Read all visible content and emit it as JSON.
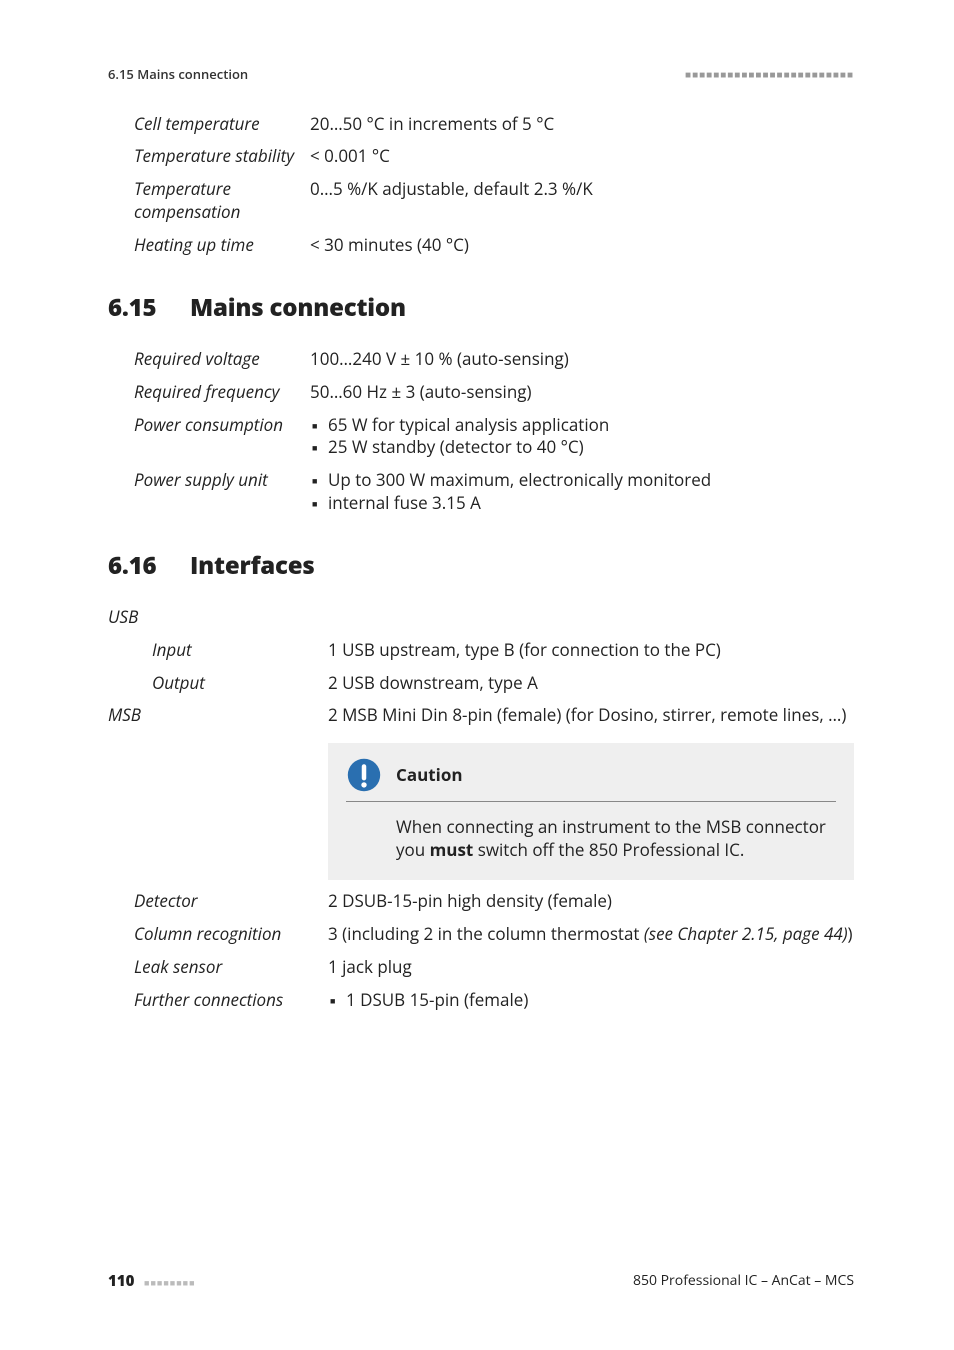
{
  "header": {
    "section_ref": "6.15 Mains connection",
    "rule": "■■■■■■■■■■■■■■■■■■■■■■■■"
  },
  "top_specs": [
    {
      "label": "Cell tempera­ture",
      "value": "20…50 °C in increments of 5 °C"
    },
    {
      "label": "Temperature stability",
      "value": "< 0.001 °C"
    },
    {
      "label": "Temperature compensation",
      "value": "0…5 %/K adjustable, default 2.3 %/K"
    },
    {
      "label": "Heating up time",
      "value": "< 30 minutes (40 °C)"
    }
  ],
  "sec615": {
    "num": "6.15",
    "title": "Mains connection",
    "rows": {
      "req_voltage": {
        "label": "Required voltage",
        "value": "100…240 V ± 10 % (auto-sensing)"
      },
      "req_freq": {
        "label": "Required fre­quency",
        "value": "50…60 Hz ± 3 (auto-sensing)"
      },
      "power_cons": {
        "label": "Power consump­tion",
        "items": [
          "65 W for typical analysis application",
          "25 W standby (detector to 40 °C)"
        ]
      },
      "psu": {
        "label": "Power supply unit",
        "items": [
          "Up to 300 W maximum, electronically monitored",
          "internal fuse 3.15 A"
        ]
      }
    }
  },
  "sec616": {
    "num": "6.16",
    "title": "Interfaces",
    "usb": {
      "group": "USB",
      "input": {
        "label": "Input",
        "value": "1 USB upstream, type B (for connection to the PC)"
      },
      "output": {
        "label": "Output",
        "value": "2 USB downstream, type A"
      }
    },
    "msb": {
      "label": "MSB",
      "value": "2 MSB Mini Din 8-pin (female) (for Dosino, stirrer, remote lines, …)"
    },
    "caution": {
      "title": "Caution",
      "body_pre": "When connecting an instrument to the MSB connector you ",
      "body_strong": "must",
      "body_post": " switch off the 850 Professional IC."
    },
    "detector": {
      "label": "Detector",
      "value": "2 DSUB-15-pin high density (female)"
    },
    "column": {
      "label": "Column recogni­tion",
      "value_pre": "3 (including 2 in the column thermostat ",
      "value_ref": "(see Chapter 2.15, page 44)",
      "value_post": ")"
    },
    "leak": {
      "label": "Leak sensor",
      "value": "1 jack plug"
    },
    "further": {
      "label": "Further connec­tions",
      "items": [
        "1 DSUB 15-pin (female)"
      ]
    }
  },
  "footer": {
    "page": "110",
    "rule": "■■■■■■■■",
    "doc": "850 Professional IC – AnCat – MCS"
  }
}
